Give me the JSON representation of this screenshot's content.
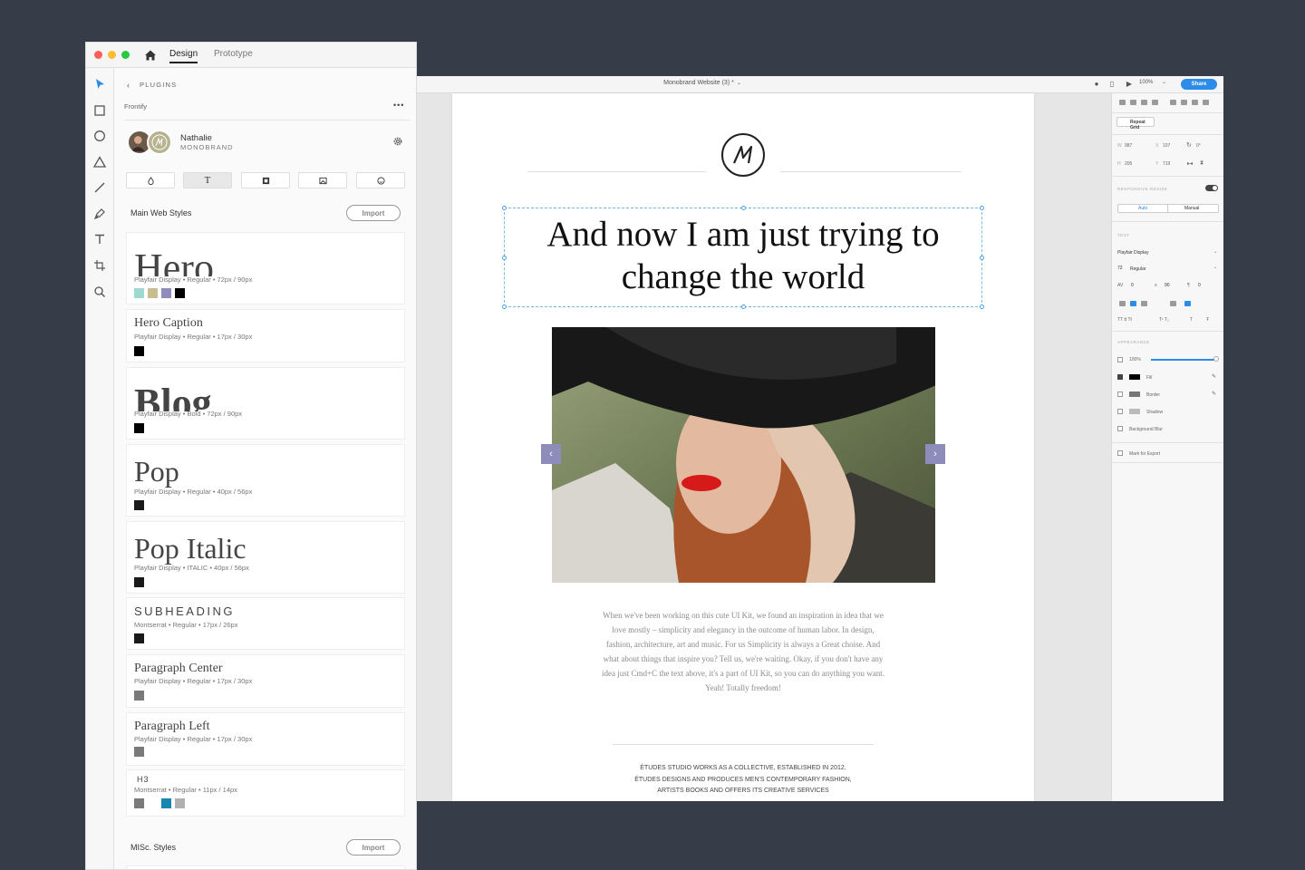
{
  "back_window": {
    "doc_title": "Monobrand Website (3) *",
    "zoom": "100%",
    "share_label": "Share",
    "artboard": {
      "heading": "And now I am just trying to change the world",
      "paragraph": "When we've been working on this cute UI Kit, we found an inspiration in idea that we love mostly – simplicity and elegancy in the outcome of human labor. In design, fashion, architecture, art and music. For us Simplicity is always a Great choise. And what about things that inspire you? Tell us, we're waiting. Okay, if you don't have any idea just Cmd+C the text above, it's a part of UI Kit, so you can do anything you want. Yeah! Totally freedom!",
      "about": "ÉTUDES STUDIO WORKS AS A COLLECTIVE, ESTABLISHED IN 2012. ÉTUDES DESIGNS AND PRODUCES MEN'S CONTEMPORARY FASHION, ARTISTS BOOKS AND OFFERS ITS CREATIVE SERVICES",
      "carousel_prev": "‹",
      "carousel_next": "›"
    },
    "inspector": {
      "repeat_grid": "Repeat Grid",
      "w": "W",
      "w_val": "987",
      "x": "X",
      "x_val": "107",
      "rot": "0°",
      "h": "H",
      "h_val": "205",
      "y": "Y",
      "y_val": "719",
      "responsive_resize": "RESPONSIVE RESIZE",
      "auto": "Auto",
      "manual": "Manual",
      "text_section": "TEXT",
      "font_family": "Playfair Display",
      "font_size": "72",
      "font_weight": "Regular",
      "char_spacing": "0",
      "line_spacing": "90",
      "para_spacing": "0",
      "appearance": "APPEARANCE",
      "opacity": "100%",
      "fill": "Fill",
      "border": "Border",
      "shadow": "Shadow",
      "background_blur": "Background Blur",
      "mark_export": "Mark for Export"
    }
  },
  "panel": {
    "tabs": {
      "design": "Design",
      "prototype": "Prototype"
    },
    "plugins_label": "PLUGINS",
    "plugin_name": "Frontify",
    "user": {
      "name": "Nathalie",
      "org": "MONOBRAND"
    },
    "categories": [
      "color-drop",
      "T",
      "pattern",
      "image",
      "icon"
    ],
    "main_section": "Main Web Styles",
    "misc_section": "MISc. Styles",
    "import_label": "Import",
    "styles": [
      {
        "title": "Hero",
        "meta": "Playfair Display • Regular • 72px / 90px",
        "swatches": [
          "#9ed9d1",
          "#c9bd8f",
          "#8d8cba",
          "#000000"
        ]
      },
      {
        "title": "Hero Caption",
        "meta": "Playfair Display • Regular • 17px / 30px",
        "swatches": [
          "#000000"
        ]
      },
      {
        "title": "Blog",
        "meta": "Playfair Display • Bold • 72px / 90px",
        "swatches": [
          "#000000"
        ]
      },
      {
        "title": "Pop",
        "meta": "Playfair Display • Regular • 40px / 56px",
        "swatches": [
          "#1a1a1a"
        ]
      },
      {
        "title": "Pop Italic",
        "meta": "Playfair Display • ITALIC • 40px / 56px",
        "swatches": [
          "#1a1a1a"
        ]
      },
      {
        "title": "SUBHEADING",
        "meta": "Montserrat • Regular • 17px / 26px",
        "swatches": [
          "#1a1a1a"
        ]
      },
      {
        "title": "Paragraph Center",
        "meta": "Playfair Display • Regular • 17px / 30px",
        "swatches": [
          "#7a7a7a"
        ]
      },
      {
        "title": "Paragraph Left",
        "meta": "Playfair Display • Regular • 17px / 30px",
        "swatches": [
          "#7a7a7a"
        ]
      },
      {
        "title": "H3",
        "meta": "Montserrat • Regular • 11px / 14px",
        "swatches": [
          "#7a7a7a",
          "#ffffff",
          "#1486b0",
          "#b0b0b0"
        ]
      }
    ]
  },
  "colors": {
    "accent": "#2d8ce8",
    "carousel": "#8d8cba",
    "bg": "#363d49"
  }
}
